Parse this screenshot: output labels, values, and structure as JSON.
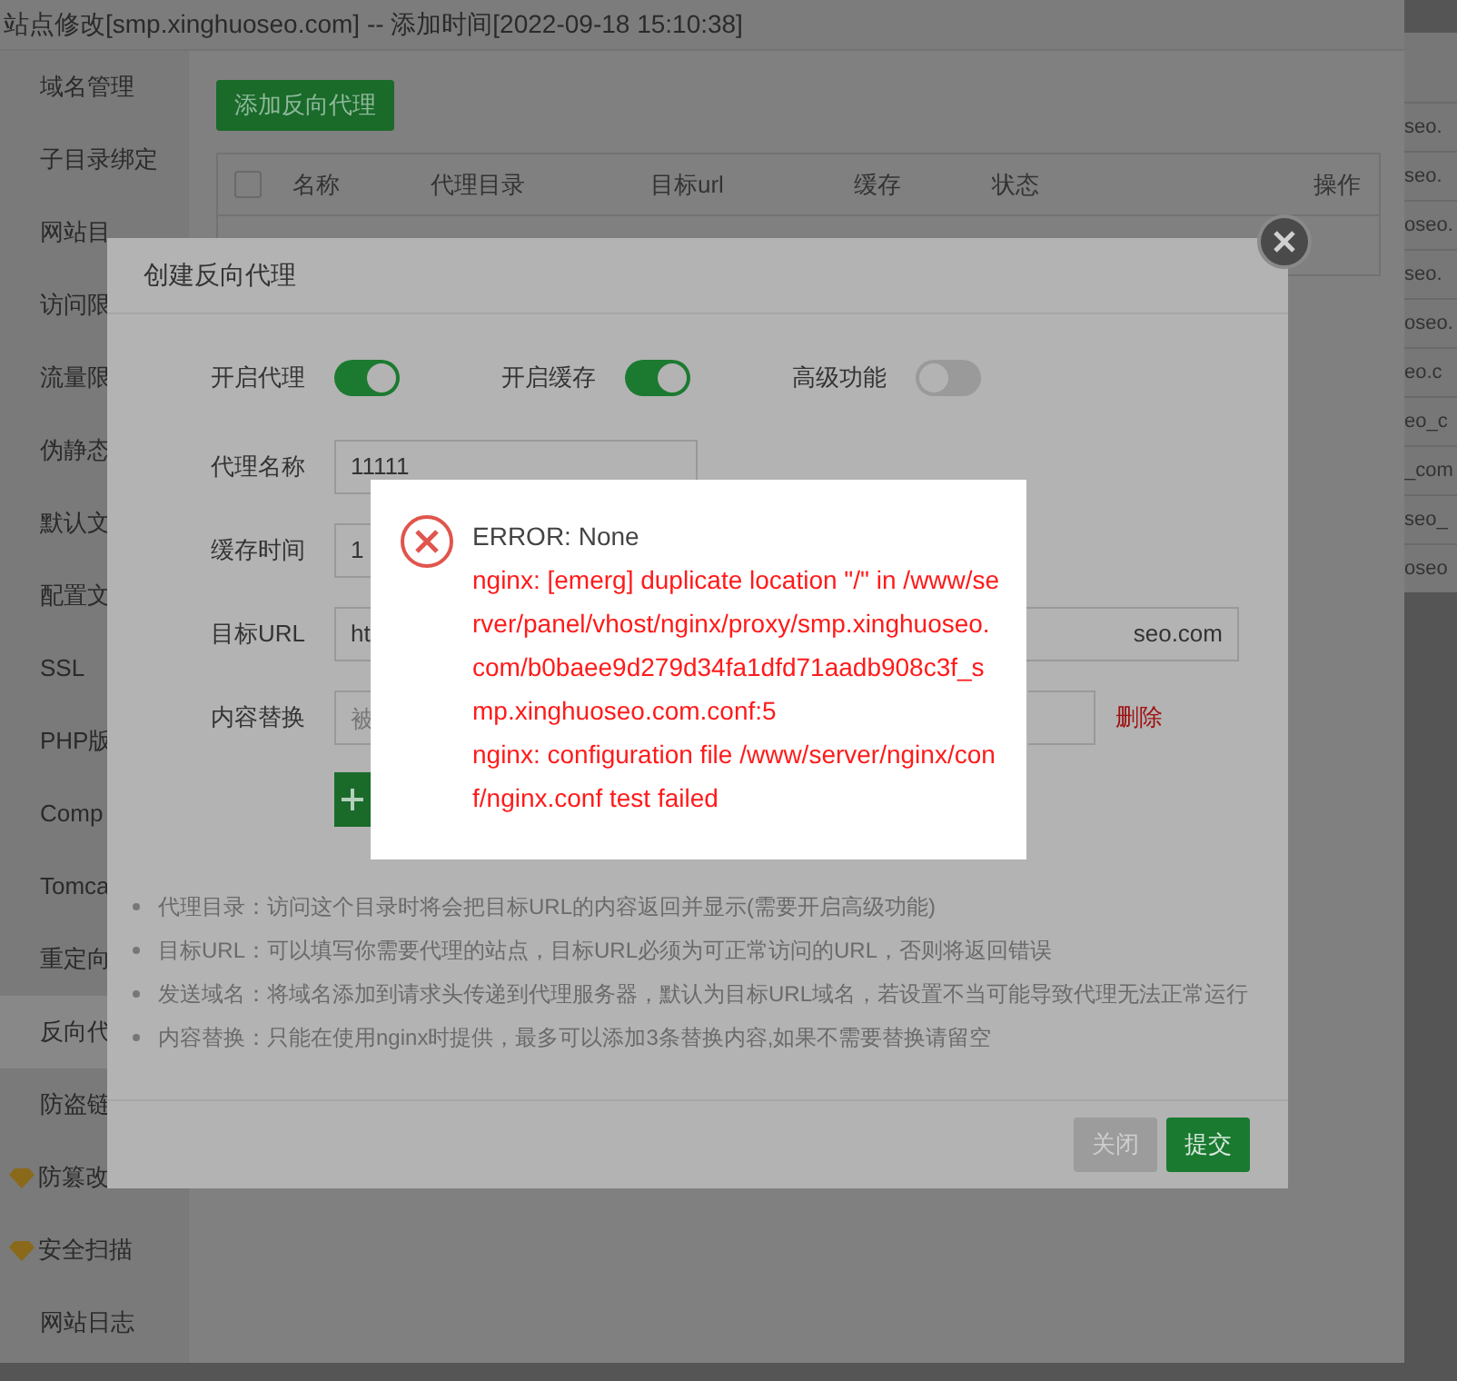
{
  "window": {
    "title": "站点修改[smp.xinghuoseo.com] -- 添加时间[2022-09-18 15:10:38]"
  },
  "sidebar": {
    "items": [
      {
        "label": "域名管理",
        "selected": false,
        "premium": false
      },
      {
        "label": "子目录绑定",
        "selected": false,
        "premium": false
      },
      {
        "label": "网站目",
        "selected": false,
        "premium": false
      },
      {
        "label": "访问限",
        "selected": false,
        "premium": false
      },
      {
        "label": "流量限",
        "selected": false,
        "premium": false
      },
      {
        "label": "伪静态",
        "selected": false,
        "premium": false
      },
      {
        "label": "默认文",
        "selected": false,
        "premium": false
      },
      {
        "label": "配置文",
        "selected": false,
        "premium": false
      },
      {
        "label": "SSL",
        "selected": false,
        "premium": false
      },
      {
        "label": "PHP版",
        "selected": false,
        "premium": false
      },
      {
        "label": "Comp",
        "selected": false,
        "premium": false
      },
      {
        "label": "Tomca",
        "selected": false,
        "premium": false
      },
      {
        "label": "重定向",
        "selected": false,
        "premium": false
      },
      {
        "label": "反向代",
        "selected": true,
        "premium": false
      },
      {
        "label": "防盗链",
        "selected": false,
        "premium": false
      },
      {
        "label": "防篡改",
        "selected": false,
        "premium": true
      },
      {
        "label": "安全扫描",
        "selected": false,
        "premium": true
      },
      {
        "label": "网站日志",
        "selected": false,
        "premium": false
      }
    ]
  },
  "add_button": "添加反向代理",
  "table": {
    "checked": false,
    "columns": [
      "名称",
      "代理目录",
      "目标url",
      "缓存",
      "状态",
      "操作"
    ]
  },
  "background_list": [
    "seo.",
    "seo.",
    "oseo.",
    "seo.",
    "oseo.",
    "eo.c",
    "eo_c",
    "_com",
    "seo_",
    "oseo"
  ],
  "dialog": {
    "title": "创建反向代理",
    "toggles": [
      {
        "label": "开启代理",
        "on": true
      },
      {
        "label": "开启缓存",
        "on": true
      },
      {
        "label": "高级功能",
        "on": false
      }
    ],
    "fields": [
      {
        "label": "代理名称",
        "value": "11111"
      },
      {
        "label": "缓存时间",
        "value": "1"
      },
      {
        "label": "目标URL",
        "value": "ht",
        "value_end": "seo.com"
      }
    ],
    "replace": {
      "label": "内容替换",
      "placeholder": "被",
      "delete": "删除"
    },
    "notes": [
      "代理目录：访问这个目录时将会把目标URL的内容返回并显示(需要开启高级功能)",
      "目标URL：可以填写你需要代理的站点，目标URL必须为可正常访问的URL，否则将返回错误",
      "发送域名：将域名添加到请求头传递到代理服务器，默认为目标URL域名，若设置不当可能导致代理无法正常运行",
      "内容替换：只能在使用nginx时提供，最多可以添加3条替换内容,如果不需要替换请留空"
    ],
    "buttons": [
      {
        "label": "关闭",
        "kind": "secondary"
      },
      {
        "label": "提交",
        "kind": "primary"
      }
    ]
  },
  "error": {
    "title": "ERROR: None",
    "lines": [
      "nginx: [emerg] duplicate location \"/\" in /www/server/panel/vhost/nginx/proxy/smp.xinghuoseo.com/b0baee9d279d34fa1dfd71aadb908c3f_smp.xinghuoseo.com.conf:5",
      "nginx: configuration file /www/server/nginx/conf/nginx.conf test failed"
    ]
  }
}
